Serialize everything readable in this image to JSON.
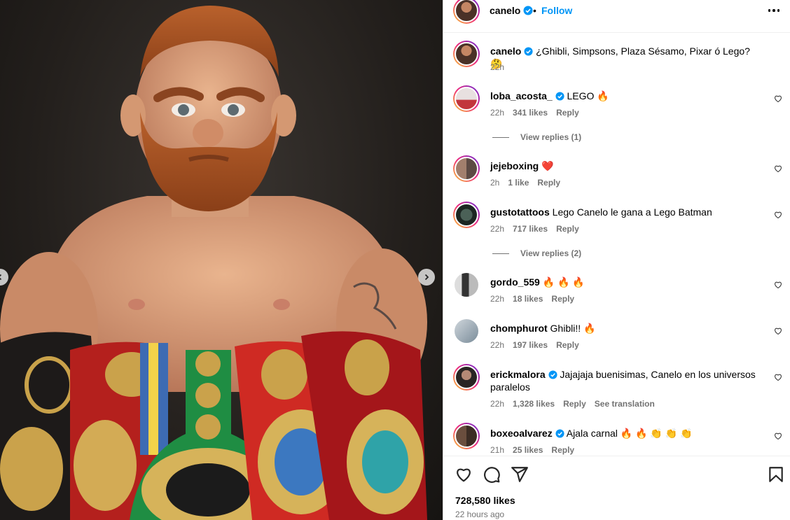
{
  "post": {
    "author": "canelo",
    "follow_label": "Follow",
    "separator": "•",
    "caption_author": "canelo",
    "caption": "¿Ghibli, Simpsons, Plaza Sésamo, Pixar ó Lego? 🤔",
    "caption_time": "22h",
    "likes": "728,580 likes",
    "time_ago": "22 hours ago"
  },
  "comments": [
    {
      "user": "loba_acosta_",
      "verified": true,
      "text": "LEGO 🔥",
      "time": "22h",
      "likes": "341 likes",
      "reply": "Reply",
      "view_replies": "View replies (1)"
    },
    {
      "user": "jejeboxing",
      "verified": false,
      "text": "❤️",
      "time": "2h",
      "likes": "1 like",
      "reply": "Reply"
    },
    {
      "user": "gustotattoos",
      "verified": false,
      "text": "Lego Canelo le gana a Lego Batman",
      "time": "22h",
      "likes": "717 likes",
      "reply": "Reply",
      "view_replies": "View replies (2)"
    },
    {
      "user": "gordo_559",
      "verified": false,
      "text": "🔥 🔥 🔥",
      "time": "22h",
      "likes": "18 likes",
      "reply": "Reply"
    },
    {
      "user": "chomphurot",
      "verified": false,
      "text": "Ghibli!! 🔥",
      "time": "22h",
      "likes": "197 likes",
      "reply": "Reply"
    },
    {
      "user": "erickmalora",
      "verified": true,
      "text": "Jajajaja buenisimas, Canelo en los universos paralelos",
      "time": "22h",
      "likes": "1,328 likes",
      "reply": "Reply",
      "translate": "See translation"
    },
    {
      "user": "boxeoalvarez",
      "verified": true,
      "text": "Ajala carnal 🔥 🔥 👏 👏 👏",
      "time": "21h",
      "likes": "25 likes",
      "reply": "Reply"
    }
  ],
  "colors": {
    "link": "#0095f6",
    "verified": "#0095f6",
    "muted": "#737373"
  },
  "icons": [
    "heart-icon",
    "comment-icon",
    "share-icon",
    "bookmark-icon",
    "more-icon",
    "chevron-left-icon",
    "chevron-right-icon",
    "verified-badge-icon"
  ]
}
